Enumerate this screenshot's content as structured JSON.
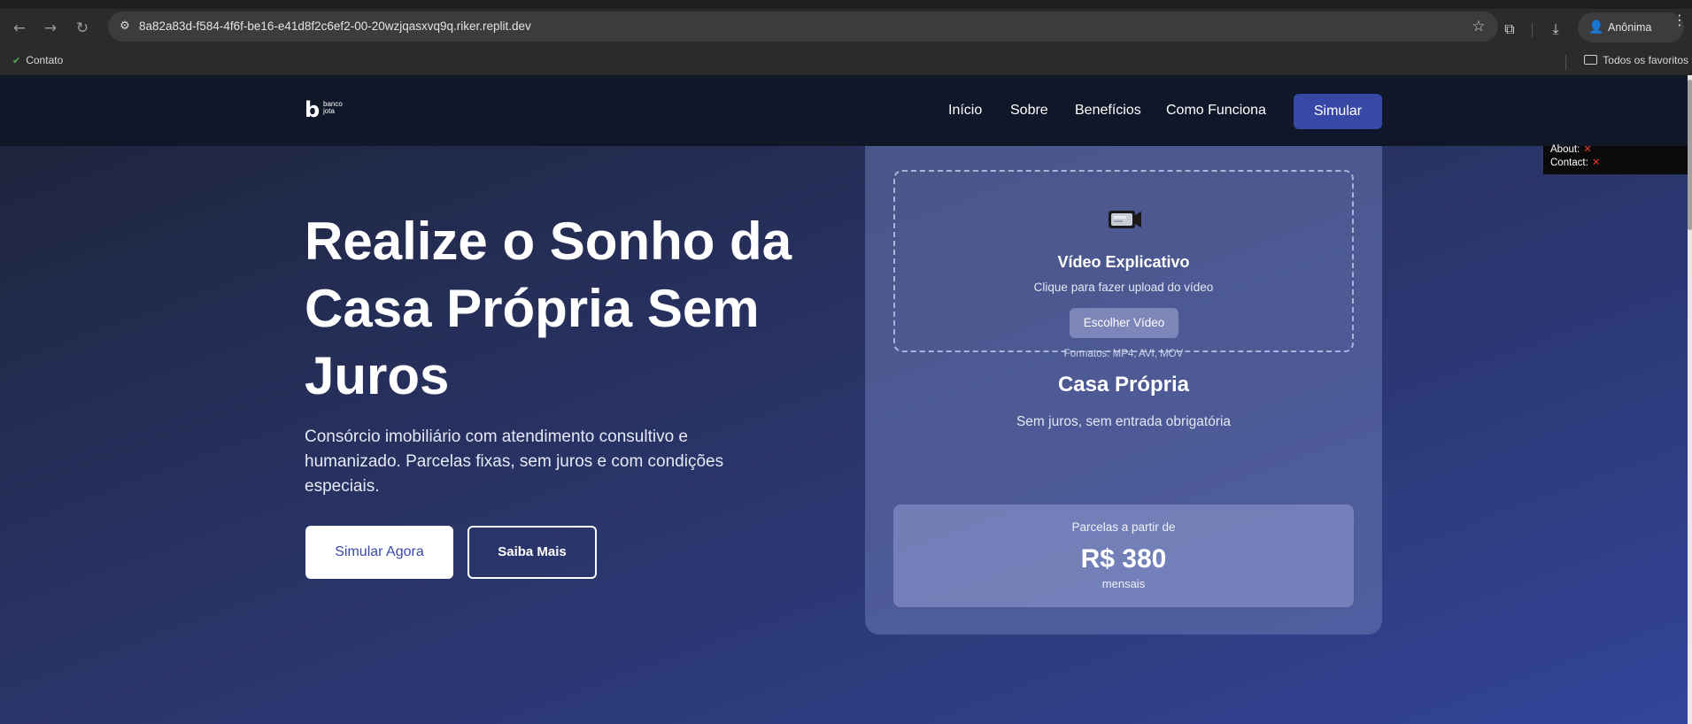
{
  "browser": {
    "url": "8a82a83d-f584-4f6f-be16-e41d8f2c6ef2-00-20wzjqasxvq9q.riker.replit.dev",
    "profile_label": "Anônima",
    "bookmark_item": "Contato",
    "bookmarks_folder": "Todos os favoritos",
    "icons": {
      "back": "←",
      "forward": "→",
      "reload": "↻",
      "site_info": "⚙",
      "star": "☆",
      "extensions": "⧉",
      "download": "⤓",
      "menu": "⋮",
      "incognito": "👤"
    }
  },
  "site": {
    "logo_text_line1": "banco",
    "logo_text_line2": "jota",
    "nav": [
      "Início",
      "Sobre",
      "Benefícios",
      "Como Funciona"
    ],
    "nav_cta": "Simular",
    "accent_color": "#3748a6"
  },
  "hero": {
    "title": "Realize o Sonho da Casa Própria Sem Juros",
    "subtitle": "Consórcio imobiliário com atendimento consultivo e humanizado. Parcelas fixas, sem juros e com condições especiais.",
    "primary_button": "Simular Agora",
    "secondary_button": "Saiba Mais"
  },
  "card": {
    "upload_title": "Vídeo Explicativo",
    "upload_hint": "Clique para fazer upload do vídeo",
    "upload_button": "Escolher Vídeo",
    "upload_formats": "Formatos: MP4, AVI, MOV",
    "title": "Casa Própria",
    "subtitle": "Sem juros, sem entrada obrigatória",
    "price_label": "Parcelas a partir de",
    "price_value": "R$ 380",
    "price_unit": "mensais"
  },
  "debug_overlay": {
    "about_label": "About:",
    "contact_label": "Contact:",
    "status_mark": "✕"
  }
}
